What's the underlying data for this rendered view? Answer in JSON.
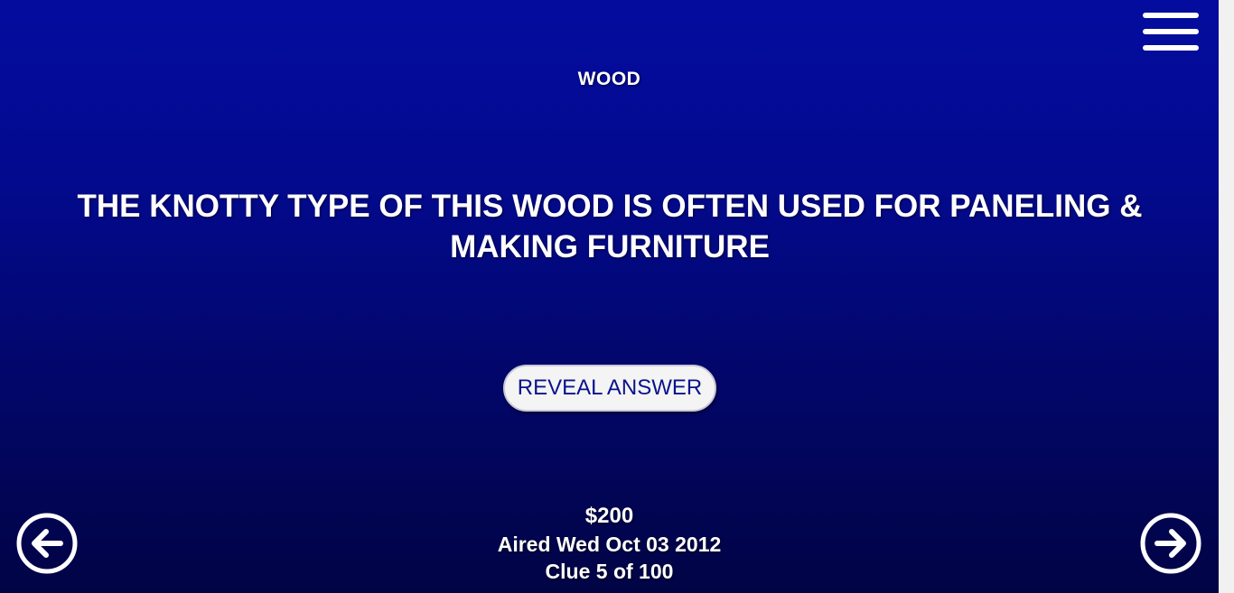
{
  "game": {
    "category": "WOOD",
    "clue": "THE KNOTTY TYPE OF THIS WOOD IS OFTEN USED FOR PANELING & MAKING FURNITURE",
    "reveal_label": "REVEAL ANSWER",
    "value": "$200",
    "aired": "Aired Wed Oct 03 2012",
    "clue_counter": "Clue 5 of 100"
  },
  "icons": {
    "menu": "hamburger-menu-icon",
    "previous": "arrow-left-circle-icon",
    "next": "arrow-right-circle-icon"
  },
  "colors": {
    "background_top": "#040c9f",
    "background_bottom": "#010444",
    "text": "#ffffff",
    "button_background": "#f4f4f4",
    "button_text": "#0a138c"
  }
}
